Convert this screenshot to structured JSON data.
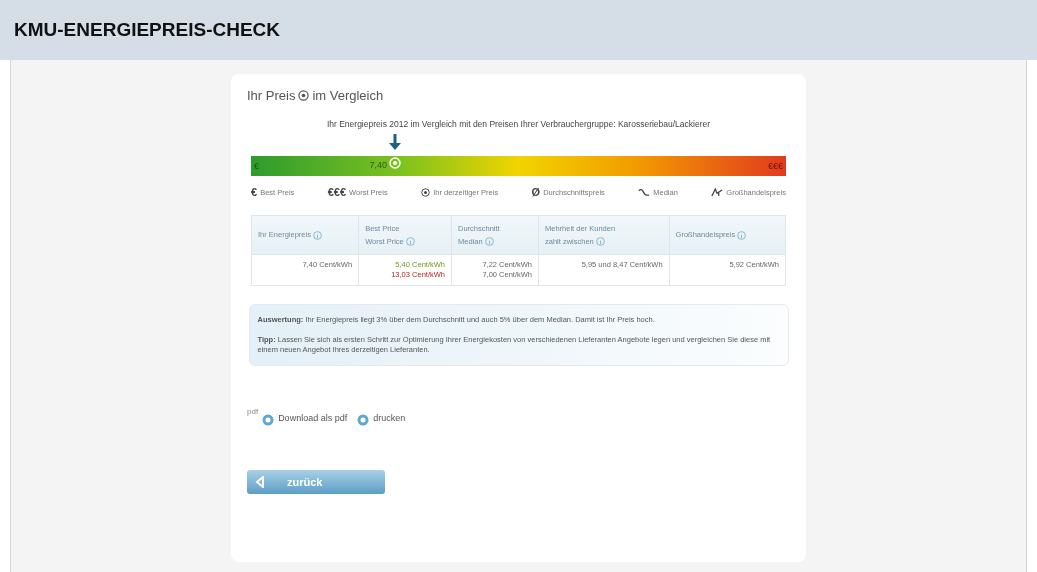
{
  "header": {
    "title": "KMU-ENERGIEPREIS-CHECK"
  },
  "card": {
    "heading": "Ihr Preis",
    "heading_suffix": "im Vergleich",
    "subtitle": "Ihr Energiepreis 2012 im Vergleich mit den Preisen Ihrer Verbrauchergruppe: Karosseriebau/Lackierer",
    "scale": {
      "level": 0.27,
      "left_label": "€",
      "right_label": "€€€",
      "marker_label": "7,40"
    },
    "legend": [
      {
        "kind": "best",
        "symbol": "€",
        "label": "Best Preis"
      },
      {
        "kind": "worst",
        "symbol": "€€€",
        "label": "Worst Preis"
      },
      {
        "kind": "current",
        "label": "Ihr derzeitiger Preis"
      },
      {
        "kind": "average",
        "symbol": "Ø",
        "label": "Durchschnittspreis"
      },
      {
        "kind": "median",
        "label": "Median"
      },
      {
        "kind": "wholesale",
        "label": "Großhandelspreis"
      }
    ],
    "table": {
      "columns": [
        "Ihr Energiepreis",
        "Best Price\nWorst Price",
        "Durchschnitt\nMedian",
        "Mehrheit der Kunden\nzahlt zwischen",
        "Großhandelspreis"
      ],
      "rows": [
        [
          [
            {
              "text": "7,40 Cent/kWh"
            }
          ],
          [
            {
              "text": "5,40 Cent/kWh",
              "kind": "best"
            },
            {
              "text": "13,03 Cent/kWh",
              "kind": "worst"
            }
          ],
          [
            {
              "text": "7,22 Cent/kWh"
            },
            {
              "text": "7,00 Cent/kWh"
            }
          ],
          [
            {
              "text": "5,95 und 8,47 Cent/kWh"
            }
          ],
          [
            {
              "text": "5,92 Cent/kWh"
            }
          ]
        ]
      ]
    },
    "evaluation": [
      "**Auswertung:** Ihr Energiepreis liegt 3% über dem Durchschnitt und auch 5% über dem Median. Damit ist Ihr Preis hoch.",
      "**Tipp:** Lassen Sie sich als ersten Schritt zur Optimierung Ihrer Energiekosten von verschiedenen Lieferanten Angebote legen und vergleichen Sie diese mit einem neuen Angebot Ihres derzeitigen Lieferanten."
    ],
    "pdf_tag": "pdf",
    "actions": [
      "Download als pdf",
      "drucken"
    ],
    "back_button": "zurück"
  }
}
